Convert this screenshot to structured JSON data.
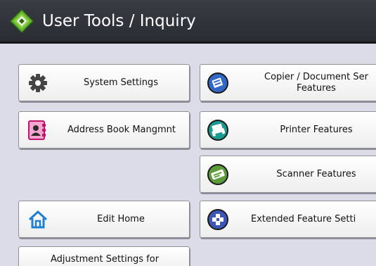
{
  "header": {
    "title": "User Tools / Inquiry"
  },
  "buttons": {
    "system_settings": "System Settings",
    "address_book": "Address Book Mangmnt",
    "edit_home": "Edit Home",
    "adjustment_settings": "Adjustment Settings for",
    "copier_features_line1": "Copier / Document Ser",
    "copier_features_line2": "Features",
    "printer_features": "Printer Features",
    "scanner_features": "Scanner Features",
    "extended_features": "Extended Feature Setti"
  },
  "icons": {
    "title": "tools-diamond-icon",
    "system_settings": "gear-icon",
    "address_book": "address-book-icon",
    "edit_home": "home-icon",
    "copier": "copier-icon",
    "printer": "printer-icon",
    "scanner": "scanner-icon",
    "extended": "extended-feature-icon"
  },
  "colors": {
    "title_bar": "#2f3138",
    "background": "#dcdce8",
    "copier_blue": "#2f68c7",
    "printer_teal": "#1a9b8e",
    "scanner_green": "#5b9b3a",
    "extended_blue": "#3d56b5",
    "address_pink": "#e3459a",
    "home_blue": "#1f7fd1"
  }
}
